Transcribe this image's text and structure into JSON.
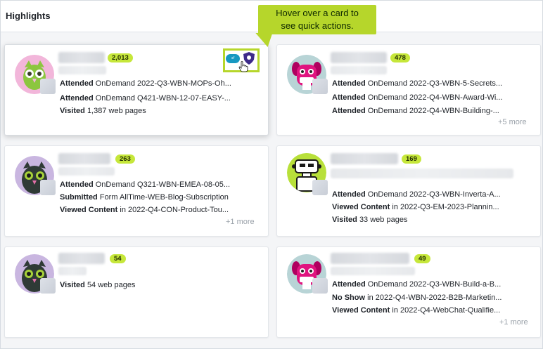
{
  "header": {
    "title": "Highlights"
  },
  "tooltip": {
    "text1": "Hover over a card to",
    "text2": "see quick actions."
  },
  "colors": {
    "accent": "#c6e73a",
    "tooltip_bg": "#b6d62b",
    "muted": "#9aa1a9"
  },
  "cards": [
    {
      "count": "2,013",
      "avatar": "owl-green-pink-icon",
      "lines": [
        {
          "verb": "Attended",
          "text": "OnDemand 2022-Q3-WBN-MOPs-Oh..."
        },
        {
          "verb": "Attended",
          "text": "OnDemand Q421-WBN-12-07-EASY-..."
        },
        {
          "verb": "Visited",
          "text": "1,387 web pages"
        }
      ],
      "more": "",
      "quick_actions": [
        "salesforce-icon",
        "shield-icon"
      ]
    },
    {
      "count": "478",
      "avatar": "dog-magenta-icon",
      "lines": [
        {
          "verb": "Attended",
          "text": "OnDemand 2022-Q3-WBN-5-Secrets..."
        },
        {
          "verb": "Attended",
          "text": "OnDemand 2022-Q4-WBN-Award-Wi..."
        },
        {
          "verb": "Attended",
          "text": "OnDemand 2022-Q4-WBN-Building-..."
        }
      ],
      "more": "+5 more"
    },
    {
      "count": "263",
      "avatar": "owl-dark-icon",
      "lines": [
        {
          "verb": "Attended",
          "text": "OnDemand Q321-WBN-EMEA-08-05..."
        },
        {
          "verb": "Submitted",
          "text": "Form AllTime-WEB-Blog-Subscription"
        },
        {
          "verb": "Viewed Content",
          "text": "in 2022-Q4-CON-Product-Tou..."
        }
      ],
      "more": "+1 more"
    },
    {
      "count": "169",
      "avatar": "robot-green-icon",
      "lines": [
        {
          "verb": "Attended",
          "text": "OnDemand 2022-Q3-WBN-Inverta-A..."
        },
        {
          "verb": "Viewed Content",
          "text": "in 2022-Q3-EM-2023-Plannin..."
        },
        {
          "verb": "Visited",
          "text": "33 web pages"
        }
      ],
      "more": ""
    },
    {
      "count": "54",
      "avatar": "owl-dark-icon",
      "lines": [
        {
          "verb": "Visited",
          "text": "54 web pages"
        }
      ],
      "more": ""
    },
    {
      "count": "49",
      "avatar": "dog-magenta-icon",
      "lines": [
        {
          "verb": "Attended",
          "text": "OnDemand 2022-Q3-WBN-Build-a-B..."
        },
        {
          "verb": "No Show",
          "text": "in 2022-Q4-WBN-2022-B2B-Marketin..."
        },
        {
          "verb": "Viewed Content",
          "text": "in 2022-Q4-WebChat-Qualifie..."
        }
      ],
      "more": "+1 more"
    }
  ]
}
